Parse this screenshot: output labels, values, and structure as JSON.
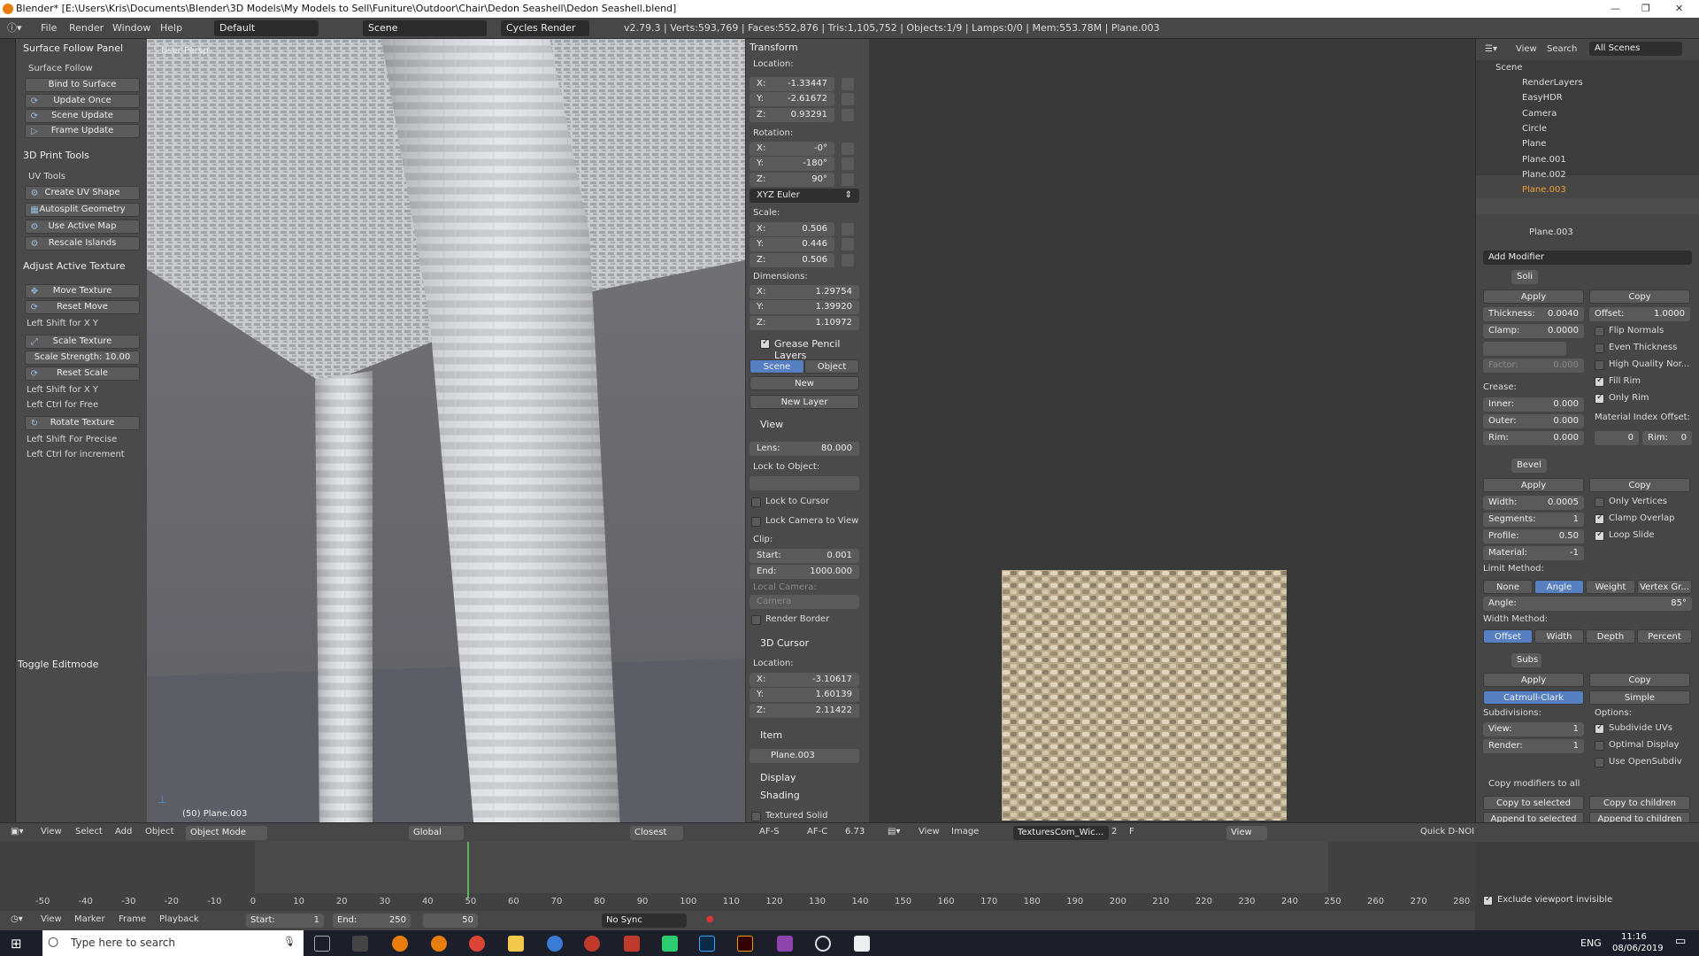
{
  "window": {
    "title": "Blender* [E:\\Users\\Kris\\Documents\\Blender\\3D Models\\My Models to Sell\\Funiture\\Outdoor\\Chair\\Dedon Seashell\\Dedon Seashell.blend]"
  },
  "infobar": {
    "menus": [
      "File",
      "Render",
      "Window",
      "Help"
    ],
    "layout": "Default",
    "scene": "Scene",
    "engine": "Cycles Render",
    "stats": "v2.79.3 | Verts:593,769 | Faces:552,876 | Tris:1,105,752 | Objects:1/9 | Lamps:0/0 | Mem:553.78M | Plane.003"
  },
  "toolshelf": {
    "surface_follow_panel": "Surface Follow Panel",
    "surface_follow": "Surface Follow",
    "bind_to_surface": "Bind to Surface",
    "update_once": "Update Once",
    "scene_update": "Scene Update",
    "frame_update": "Frame Update",
    "print_tools": "3D Print Tools",
    "uv_tools": "UV Tools",
    "create_uv_shape": "Create UV Shape",
    "autosplit_geometry": "Autosplit Geometry",
    "use_active_map": "Use Active Map",
    "rescale_islands": "Rescale Islands",
    "adjust_active_texture": "Adjust Active Texture",
    "move_texture": "Move Texture",
    "reset_move": "Reset Move",
    "left_shift_xy_1": "Left Shift for X Y",
    "scale_texture": "Scale Texture",
    "scale_strength_label": "Scale Strength:",
    "scale_strength_value": "10.00",
    "reset_scale": "Reset Scale",
    "left_shift_xy_2": "Left Shift for X Y",
    "left_ctrl_free": "Left Ctrl for Free",
    "rotate_texture": "Rotate Texture",
    "left_shift_precise": "Left Shift For Precise",
    "left_ctrl_increment": "Left Ctrl for increment",
    "toggle_editmode": "Toggle Editmode"
  },
  "viewport": {
    "label": "User Persp",
    "object_info": "(50) Plane.003"
  },
  "npanel": {
    "transform": "Transform",
    "location": "Location:",
    "loc": [
      {
        "k": "X:",
        "v": "-1.33447"
      },
      {
        "k": "Y:",
        "v": "-2.61672"
      },
      {
        "k": "Z:",
        "v": "0.93291"
      }
    ],
    "rotation": "Rotation:",
    "rot": [
      {
        "k": "X:",
        "v": "-0°"
      },
      {
        "k": "Y:",
        "v": "-180°"
      },
      {
        "k": "Z:",
        "v": "90°"
      }
    ],
    "rot_mode": "XYZ Euler",
    "scale": "Scale:",
    "scl": [
      {
        "k": "X:",
        "v": "0.506"
      },
      {
        "k": "Y:",
        "v": "0.446"
      },
      {
        "k": "Z:",
        "v": "0.506"
      }
    ],
    "dimensions": "Dimensions:",
    "dim": [
      {
        "k": "X:",
        "v": "1.29754"
      },
      {
        "k": "Y:",
        "v": "1.39920"
      },
      {
        "k": "Z:",
        "v": "1.10972"
      }
    ],
    "grease_pencil": "Grease Pencil Layers",
    "gp_scene": "Scene",
    "gp_object": "Object",
    "gp_new": "New",
    "gp_new_layer": "New Layer",
    "view": "View",
    "lens_k": "Lens:",
    "lens_v": "80.000",
    "lock_to_object": "Lock to Object:",
    "lock_to_cursor": "Lock to Cursor",
    "lock_camera": "Lock Camera to View",
    "clip": "Clip:",
    "clip_start_k": "Start:",
    "clip_start_v": "0.001",
    "clip_end_k": "End:",
    "clip_end_v": "1000.000",
    "local_camera": "Local Camera:",
    "camera": "Camera",
    "render_border": "Render Border",
    "cursor": "3D Cursor",
    "cursor_location": "Location:",
    "cur": [
      {
        "k": "X:",
        "v": "-3.10617"
      },
      {
        "k": "Y:",
        "v": "1.60139"
      },
      {
        "k": "Z:",
        "v": "2.11422"
      }
    ],
    "item": "Item",
    "item_name": "Plane.003",
    "display": "Display",
    "shading": "Shading",
    "textured_solid": "Textured Solid"
  },
  "outliner": {
    "menus": [
      "View",
      "Search"
    ],
    "filter": "All Scenes",
    "items": [
      "Scene",
      "RenderLayers",
      "EasyHDR",
      "Camera",
      "Circle",
      "Plane",
      "Plane.001",
      "Plane.002",
      "Plane.003"
    ]
  },
  "properties": {
    "object": "Plane.003",
    "add_modifier": "Add Modifier",
    "solidify": {
      "name": "Soli",
      "apply": "Apply",
      "copy": "Copy",
      "thickness_k": "Thickness:",
      "thickness_v": "0.0040",
      "offset_k": "Offset:",
      "offset_v": "1.0000",
      "clamp_k": "Clamp:",
      "clamp_v": "0.0000",
      "factor_k": "Factor:",
      "factor_v": "0.000",
      "crease": "Crease:",
      "inner_k": "Inner:",
      "inner_v": "0.000",
      "outer_k": "Outer:",
      "outer_v": "0.000",
      "rim_k": "Rim:",
      "rim_v": "0.000",
      "flip_normals": "Flip Normals",
      "even_thickness": "Even Thickness",
      "high_quality": "High Quality Nor...",
      "fill_rim": "Fill Rim",
      "only_rim": "Only Rim",
      "mat_index": "Material Index Offset:",
      "mat_v": "0",
      "rim2_k": "Rim:",
      "rim2_v": "0"
    },
    "bevel": {
      "name": "Bevel",
      "apply": "Apply",
      "copy": "Copy",
      "width_k": "Width:",
      "width_v": "0.0005",
      "segments_k": "Segments:",
      "segments_v": "1",
      "profile_k": "Profile:",
      "profile_v": "0.50",
      "material_k": "Material:",
      "material_v": "-1",
      "only_vertices": "Only Vertices",
      "clamp_overlap": "Clamp Overlap",
      "loop_slide": "Loop Slide",
      "limit_method": "Limit Method:",
      "limit": [
        "None",
        "Angle",
        "Weight",
        "Vertex Gr..."
      ],
      "angle_k": "Angle:",
      "angle_v": "85°",
      "width_method": "Width Method:",
      "wm": [
        "Offset",
        "Width",
        "Depth",
        "Percent"
      ]
    },
    "subsurf": {
      "name": "Subs",
      "apply": "Apply",
      "copy": "Copy",
      "catmull": "Catmull-Clark",
      "simple": "Simple",
      "subdivisions": "Subdivisions:",
      "options": "Options:",
      "view_k": "View:",
      "view_v": "1",
      "render_k": "Render:",
      "render_v": "1",
      "subdivide_uvs": "Subdivide UVs",
      "optimal_display": "Optimal Display",
      "use_opensubdiv": "Use OpenSubdiv"
    },
    "copy_modifiers": "Copy modifiers to all",
    "copy_to_selected": "Copy to selected",
    "copy_to_children": "Copy to children",
    "append_to_selected": "Append to selected",
    "append_to_children": "Append to children",
    "exclude_invisible": "Exclude viewport invisible"
  },
  "header3d": {
    "menus": [
      "View",
      "Select",
      "Add",
      "Object"
    ],
    "mode": "Object Mode",
    "pivot": "Global",
    "snap": "Closest",
    "afs": "AF-S",
    "afc": "AF-C",
    "afval": "6.73"
  },
  "header_img": {
    "menus": [
      "View",
      "Image"
    ],
    "image": "TexturesCom_Wic...",
    "users": "2",
    "f": "F",
    "view": "View",
    "quick": "Quick D-NOI"
  },
  "timeline": {
    "ticks": [
      "-50",
      "-40",
      "-30",
      "-20",
      "-10",
      "0",
      "10",
      "20",
      "30",
      "40",
      "50",
      "60",
      "70",
      "80",
      "90",
      "100",
      "110",
      "120",
      "130",
      "140",
      "150",
      "160",
      "170",
      "180",
      "190",
      "200",
      "210",
      "220",
      "230",
      "240",
      "250",
      "260",
      "270",
      "280"
    ],
    "current": 50,
    "menus": [
      "View",
      "Marker",
      "Frame",
      "Playback"
    ],
    "start_k": "Start:",
    "start_v": "1",
    "end_k": "End:",
    "end_v": "250",
    "frame_v": "50",
    "sync": "No Sync"
  },
  "taskbar": {
    "search": "Type here to search",
    "lang": "ENG",
    "time": "11:16",
    "date": "08/06/2019"
  },
  "colors": {
    "accent": "#5680c2",
    "panel": "#4a4a4a",
    "header": "#474747"
  }
}
